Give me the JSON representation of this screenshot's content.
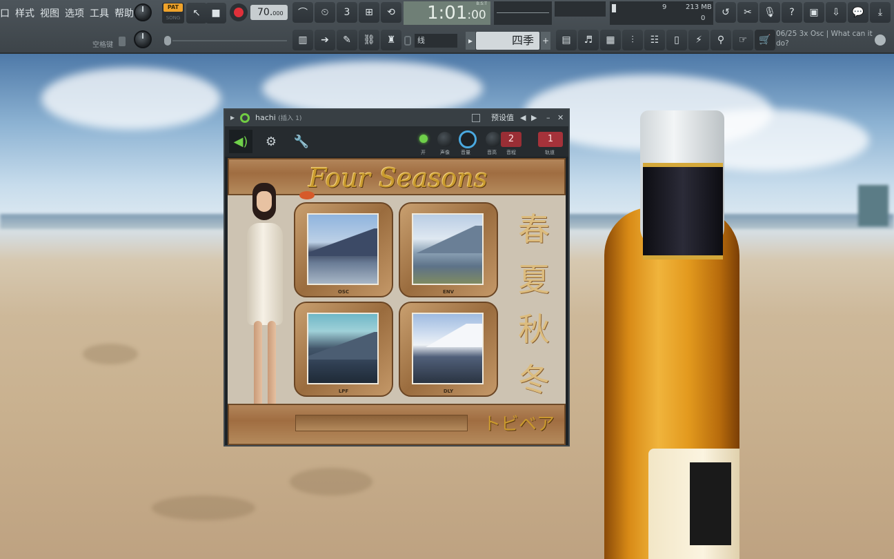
{
  "menu": {
    "items": [
      "口",
      "样式",
      "视图",
      "选项",
      "工具",
      "帮助"
    ]
  },
  "toolbar": {
    "pat_label": "PAT",
    "song_label": "SONG",
    "tempo_main": "70.",
    "tempo_frac": "000",
    "time_main": "1:01",
    "time_frac": ":00",
    "time_unit": "B:S:T",
    "memory": "213 MB",
    "cpu_value": "9",
    "cpu_polyphony": "0",
    "hint_label": "空格键",
    "snap_label": "线",
    "pattern_name": "四季",
    "pattern_prev": "▸",
    "pattern_add": "+",
    "news_text": "06/25  3x Osc | What can it do?"
  },
  "plugin": {
    "title_name": "hachi",
    "title_suffix": "(插入 1)",
    "preset_label": "预设值",
    "knob_labels": [
      "开",
      "声像",
      "音量",
      "音高",
      "音程"
    ],
    "channel_number": "2",
    "track_number": "1",
    "track_label": "轨道",
    "banner_title": "Four Seasons",
    "footer_text": "トビベア",
    "kanji": [
      "春",
      "夏",
      "秋",
      "冬"
    ],
    "frames": [
      {
        "label": "OSC"
      },
      {
        "label": "ENV"
      },
      {
        "label": "LPF"
      },
      {
        "label": "DLY"
      }
    ]
  },
  "colors": {
    "toolbar_bg": "#454c51",
    "accent_green": "#6fd04a",
    "record_red": "#e0303a",
    "channel_red": "#a5323a",
    "wood": "#a06d41",
    "gold": "#c99a2e"
  }
}
